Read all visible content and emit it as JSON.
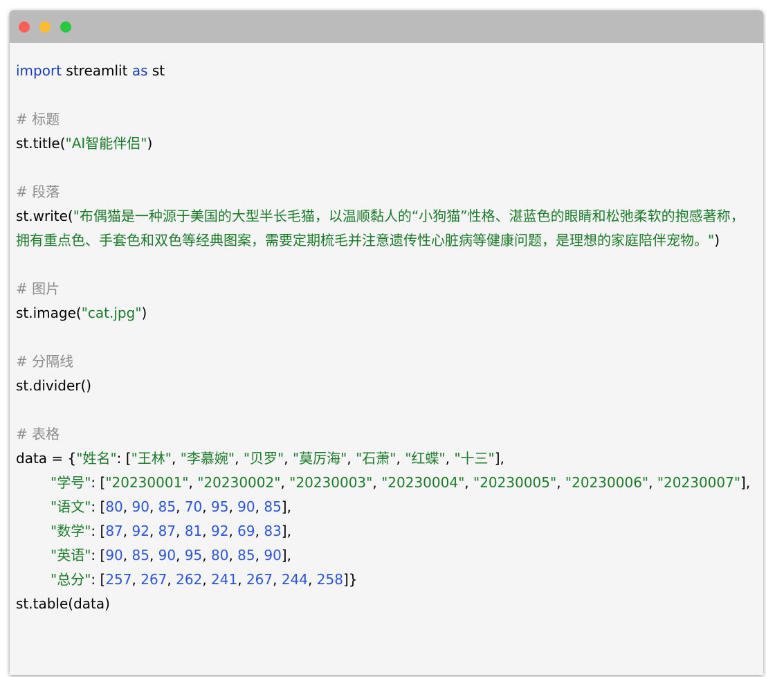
{
  "window": {
    "controls": {
      "close": "#ff5f57",
      "minimize": "#febc2e",
      "zoom": "#28c840"
    }
  },
  "code": {
    "l1": {
      "kw1": "import",
      "mod": " streamlit ",
      "kw2": "as",
      "alias": " st"
    },
    "c_title": "# 标题",
    "l_title": {
      "fn": "st.title(",
      "str": "\"AI智能伴侣\"",
      "close": ")"
    },
    "c_para": "# 段落",
    "l_write": {
      "fn": "st.write(",
      "str": "\"布偶猫是一种源于美国的大型半长毛猫，以温顺黏人的“小狗猫”性格、湛蓝色的眼睛和松弛柔软的抱感著称，拥有重点色、手套色和双色等经典图案，需要定期梳毛并注意遗传性心脏病等健康问题，是理想的家庭陪伴宠物。\"",
      "close": ")"
    },
    "c_image": "# 图片",
    "l_image": {
      "fn": "st.image(",
      "str": "\"cat.jpg\"",
      "close": ")"
    },
    "c_divider": "# 分隔线",
    "l_divider": "st.divider()",
    "c_table": "# 表格",
    "data": {
      "lead": "data = {",
      "names_key": "\"姓名\"",
      "names": [
        "\"王林\"",
        "\"李慕婉\"",
        "\"贝罗\"",
        "\"莫厉海\"",
        "\"石萧\"",
        "\"红蝶\"",
        "\"十三\""
      ],
      "ids_key": "\"学号\"",
      "ids": [
        "\"20230001\"",
        "\"20230002\"",
        "\"20230003\"",
        "\"20230004\"",
        "\"20230005\"",
        "\"20230006\"",
        "\"20230007\""
      ],
      "chinese_key": "\"语文\"",
      "chinese": [
        "80",
        "90",
        "85",
        "70",
        "95",
        "90",
        "85"
      ],
      "math_key": "\"数学\"",
      "math": [
        "87",
        "92",
        "87",
        "81",
        "92",
        "69",
        "83"
      ],
      "english_key": "\"英语\"",
      "english": [
        "90",
        "85",
        "90",
        "95",
        "80",
        "85",
        "90"
      ],
      "total_key": "\"总分\"",
      "total": [
        "257",
        "267",
        "262",
        "241",
        "267",
        "244",
        "258"
      ]
    },
    "l_table": "st.table(data)"
  },
  "colors": {
    "keyword": "#1a3eb8",
    "comment": "#8c8c8c",
    "string": "#1d7a2a",
    "number": "#2a55d6"
  }
}
